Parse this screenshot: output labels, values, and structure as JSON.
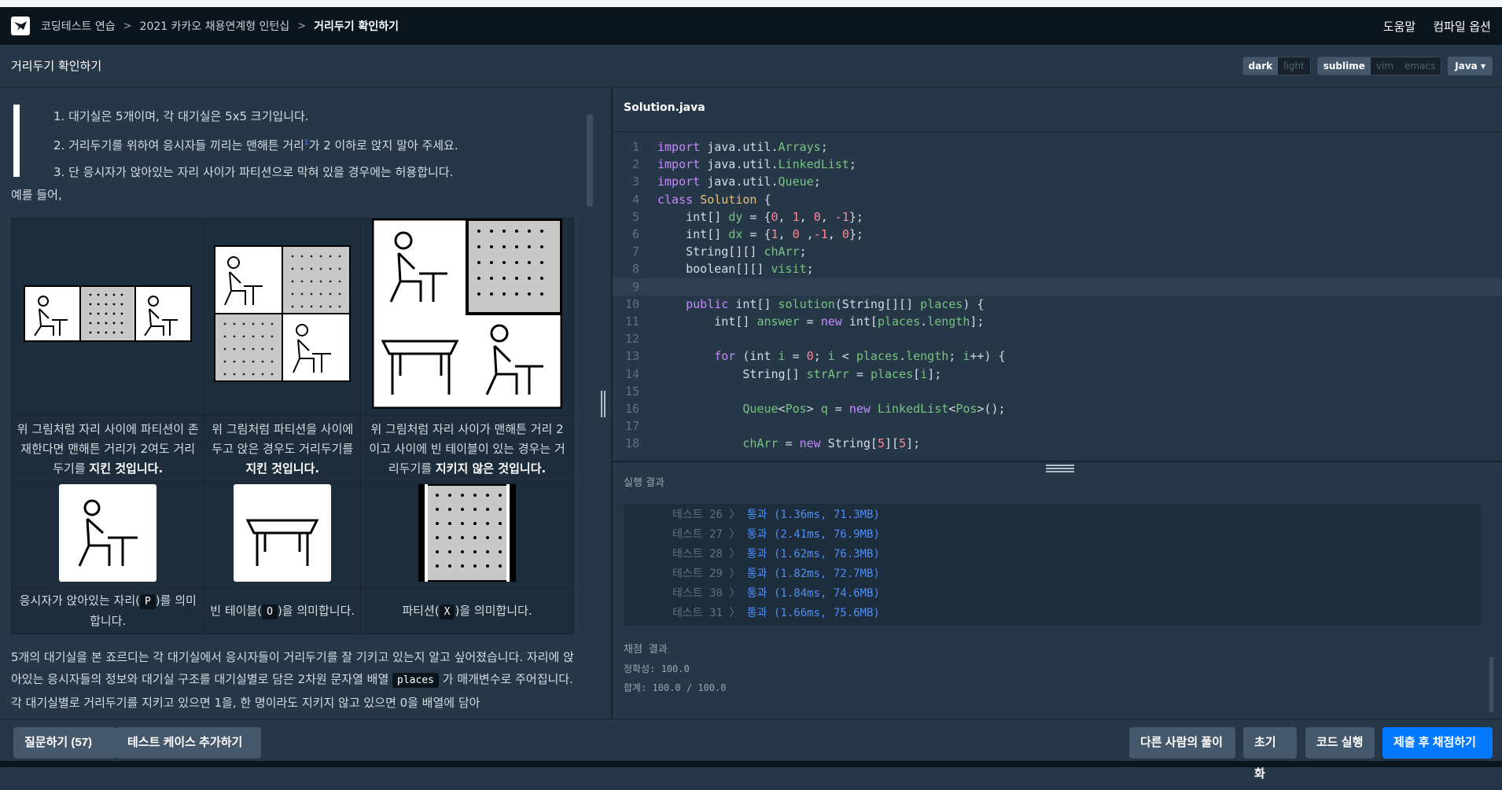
{
  "breadcrumbs": [
    "코딩테스트 연습",
    "2021 카카오 채용연계형 인턴십",
    "거리두기 확인하기"
  ],
  "top_right": {
    "help": "도움말",
    "compile_options": "컴파일 옵션"
  },
  "title": "거리두기 확인하기",
  "theme_options": [
    "dark",
    "light"
  ],
  "keymap_options": [
    "sublime",
    "vim",
    "emacs"
  ],
  "language": "Java",
  "rules": [
    "1. 대기실은 5개이며, 각 대기실은 5x5 크기입니다.",
    "2. 거리두기를 위하여 응시자들 끼리는 맨해튼 거리",
    "가 2 이하로 앉지 말아 주세요.",
    "3. 단 응시자가 앉아있는 자리 사이가 파티션으로 막혀 있을 경우에는 허용합니다."
  ],
  "example_intro": "예를 들어,",
  "examples": [
    {
      "text": "위 그림처럼 자리 사이에 파티션이 존재한다면 맨해튼 거리가 2여도 거리두기를 ",
      "bold": "지킨 것입니다."
    },
    {
      "text": "위 그림처럼 파티션을 사이에 두고 앉은 경우도 거리두기를 ",
      "bold": "지킨 것입니다."
    },
    {
      "text": "위 그림처럼 자리 사이가 맨해튼 거리 2이고 사이에 빈 테이블이 있는 경우는 거리두기를 ",
      "bold": "지키지 않은 것입니다."
    }
  ],
  "legend": [
    {
      "pre": "응시자가 앉아있는 자리(",
      "code": "P",
      "post": ")를 의미합니다."
    },
    {
      "pre": "빈 테이블(",
      "code": "O",
      "post": ")을 의미합니다."
    },
    {
      "pre": "파티션(",
      "code": "X",
      "post": ")을 의미합니다."
    }
  ],
  "description": {
    "part1": "5개의 대기실을 본 죠르디는 각 대기실에서 응시자들이 거리두기를 잘 기키고 있는지 알고 싶어졌습니다. 자리에 앉아있는 응시자들의 정보와 대기실 구조를 대기실별로 담은 2차원 문자열 배열 ",
    "code": "places",
    "part2": " 가 매개변수로 주어집니다. 각 대기실별로 거리두기를 지키고 있으면 1을, 한 명이라도 지키지 않고 있으면 0을 배열에 담아"
  },
  "file_name": "Solution.java",
  "code_lines": [
    [
      [
        "kw",
        "import"
      ],
      [
        "fn",
        " java.util."
      ],
      [
        "pk",
        "Arrays"
      ],
      [
        "fn",
        ";"
      ]
    ],
    [
      [
        "kw",
        "import"
      ],
      [
        "fn",
        " java.util."
      ],
      [
        "pk",
        "LinkedList"
      ],
      [
        "fn",
        ";"
      ]
    ],
    [
      [
        "kw",
        "import"
      ],
      [
        "fn",
        " java.util."
      ],
      [
        "pk",
        "Queue"
      ],
      [
        "fn",
        ";"
      ]
    ],
    [
      [
        "kw",
        "class"
      ],
      [
        "fn",
        " "
      ],
      [
        "ty",
        "Solution"
      ],
      [
        "fn",
        " {"
      ]
    ],
    [
      [
        "fn",
        "    int[] "
      ],
      [
        "pk",
        "dy"
      ],
      [
        "fn",
        " = {"
      ],
      [
        "num",
        "0"
      ],
      [
        "fn",
        ", "
      ],
      [
        "num",
        "1"
      ],
      [
        "fn",
        ", "
      ],
      [
        "num",
        "0"
      ],
      [
        "fn",
        ", "
      ],
      [
        "num",
        "-1"
      ],
      [
        "fn",
        "};"
      ]
    ],
    [
      [
        "fn",
        "    int[] "
      ],
      [
        "pk",
        "dx"
      ],
      [
        "fn",
        " = {"
      ],
      [
        "num",
        "1"
      ],
      [
        "fn",
        ", "
      ],
      [
        "num",
        "0"
      ],
      [
        "fn",
        " ,"
      ],
      [
        "num",
        "-1"
      ],
      [
        "fn",
        ", "
      ],
      [
        "num",
        "0"
      ],
      [
        "fn",
        "};"
      ]
    ],
    [
      [
        "fn",
        "    String[][] "
      ],
      [
        "pk",
        "chArr"
      ],
      [
        "fn",
        ";"
      ]
    ],
    [
      [
        "fn",
        "    boolean[][] "
      ],
      [
        "pk",
        "visit"
      ],
      [
        "fn",
        ";"
      ]
    ],
    [
      [
        "fn",
        ""
      ]
    ],
    [
      [
        "fn",
        "    "
      ],
      [
        "kw",
        "public"
      ],
      [
        "fn",
        " int[] "
      ],
      [
        "pk",
        "solution"
      ],
      [
        "fn",
        "(String[][] "
      ],
      [
        "pk",
        "places"
      ],
      [
        "fn",
        ") {"
      ]
    ],
    [
      [
        "fn",
        "        int[] "
      ],
      [
        "pk",
        "answer"
      ],
      [
        "fn",
        " = "
      ],
      [
        "kw",
        "new"
      ],
      [
        "fn",
        " int["
      ],
      [
        "pk",
        "places"
      ],
      [
        "fn",
        "."
      ],
      [
        "pk",
        "length"
      ],
      [
        "fn",
        "];"
      ]
    ],
    [
      [
        "fn",
        ""
      ]
    ],
    [
      [
        "fn",
        "        "
      ],
      [
        "kw",
        "for"
      ],
      [
        "fn",
        " (int "
      ],
      [
        "pk",
        "i"
      ],
      [
        "fn",
        " = "
      ],
      [
        "num",
        "0"
      ],
      [
        "fn",
        "; "
      ],
      [
        "pk",
        "i"
      ],
      [
        "fn",
        " < "
      ],
      [
        "pk",
        "places"
      ],
      [
        "fn",
        "."
      ],
      [
        "pk",
        "length"
      ],
      [
        "fn",
        "; "
      ],
      [
        "pk",
        "i"
      ],
      [
        "fn",
        "++) {"
      ]
    ],
    [
      [
        "fn",
        "            String[] "
      ],
      [
        "pk",
        "strArr"
      ],
      [
        "fn",
        " = "
      ],
      [
        "pk",
        "places"
      ],
      [
        "fn",
        "["
      ],
      [
        "pk",
        "i"
      ],
      [
        "fn",
        "];"
      ]
    ],
    [
      [
        "fn",
        ""
      ]
    ],
    [
      [
        "fn",
        "            "
      ],
      [
        "pk",
        "Queue"
      ],
      [
        "fn",
        "<"
      ],
      [
        "pk",
        "Pos"
      ],
      [
        "fn",
        "> "
      ],
      [
        "pk",
        "q"
      ],
      [
        "fn",
        " = "
      ],
      [
        "kw",
        "new"
      ],
      [
        "fn",
        " "
      ],
      [
        "pk",
        "LinkedList"
      ],
      [
        "fn",
        "<"
      ],
      [
        "pk",
        "Pos"
      ],
      [
        "fn",
        ">();"
      ]
    ],
    [
      [
        "fn",
        ""
      ]
    ],
    [
      [
        "fn",
        "            "
      ],
      [
        "pk",
        "chArr"
      ],
      [
        "fn",
        " = "
      ],
      [
        "kw",
        "new"
      ],
      [
        "fn",
        " String["
      ],
      [
        "num",
        "5"
      ],
      [
        "fn",
        "]["
      ],
      [
        "num",
        "5"
      ],
      [
        "fn",
        "];"
      ]
    ]
  ],
  "result_label": "실행 결과",
  "results": [
    {
      "name": "테스트 26 〉",
      "value": "통과 (1.36ms, 71.3MB)"
    },
    {
      "name": "테스트 27 〉",
      "value": "통과 (2.41ms, 76.9MB)"
    },
    {
      "name": "테스트 28 〉",
      "value": "통과 (1.62ms, 76.3MB)"
    },
    {
      "name": "테스트 29 〉",
      "value": "통과 (1.82ms, 72.7MB)"
    },
    {
      "name": "테스트 30 〉",
      "value": "통과 (1.84ms, 74.6MB)"
    },
    {
      "name": "테스트 31 〉",
      "value": "통과 (1.66ms, 75.6MB)"
    }
  ],
  "grading": {
    "title": "채점 결과",
    "accuracy": "정확성: 100.0",
    "total": "합계: 100.0 / 100.0"
  },
  "footer_left": [
    "질문하기 (57)",
    "테스트 케이스 추가하기"
  ],
  "footer_right": [
    "다른 사람의 풀이",
    "초기화",
    "코드 실행",
    "제출 후 채점하기"
  ]
}
